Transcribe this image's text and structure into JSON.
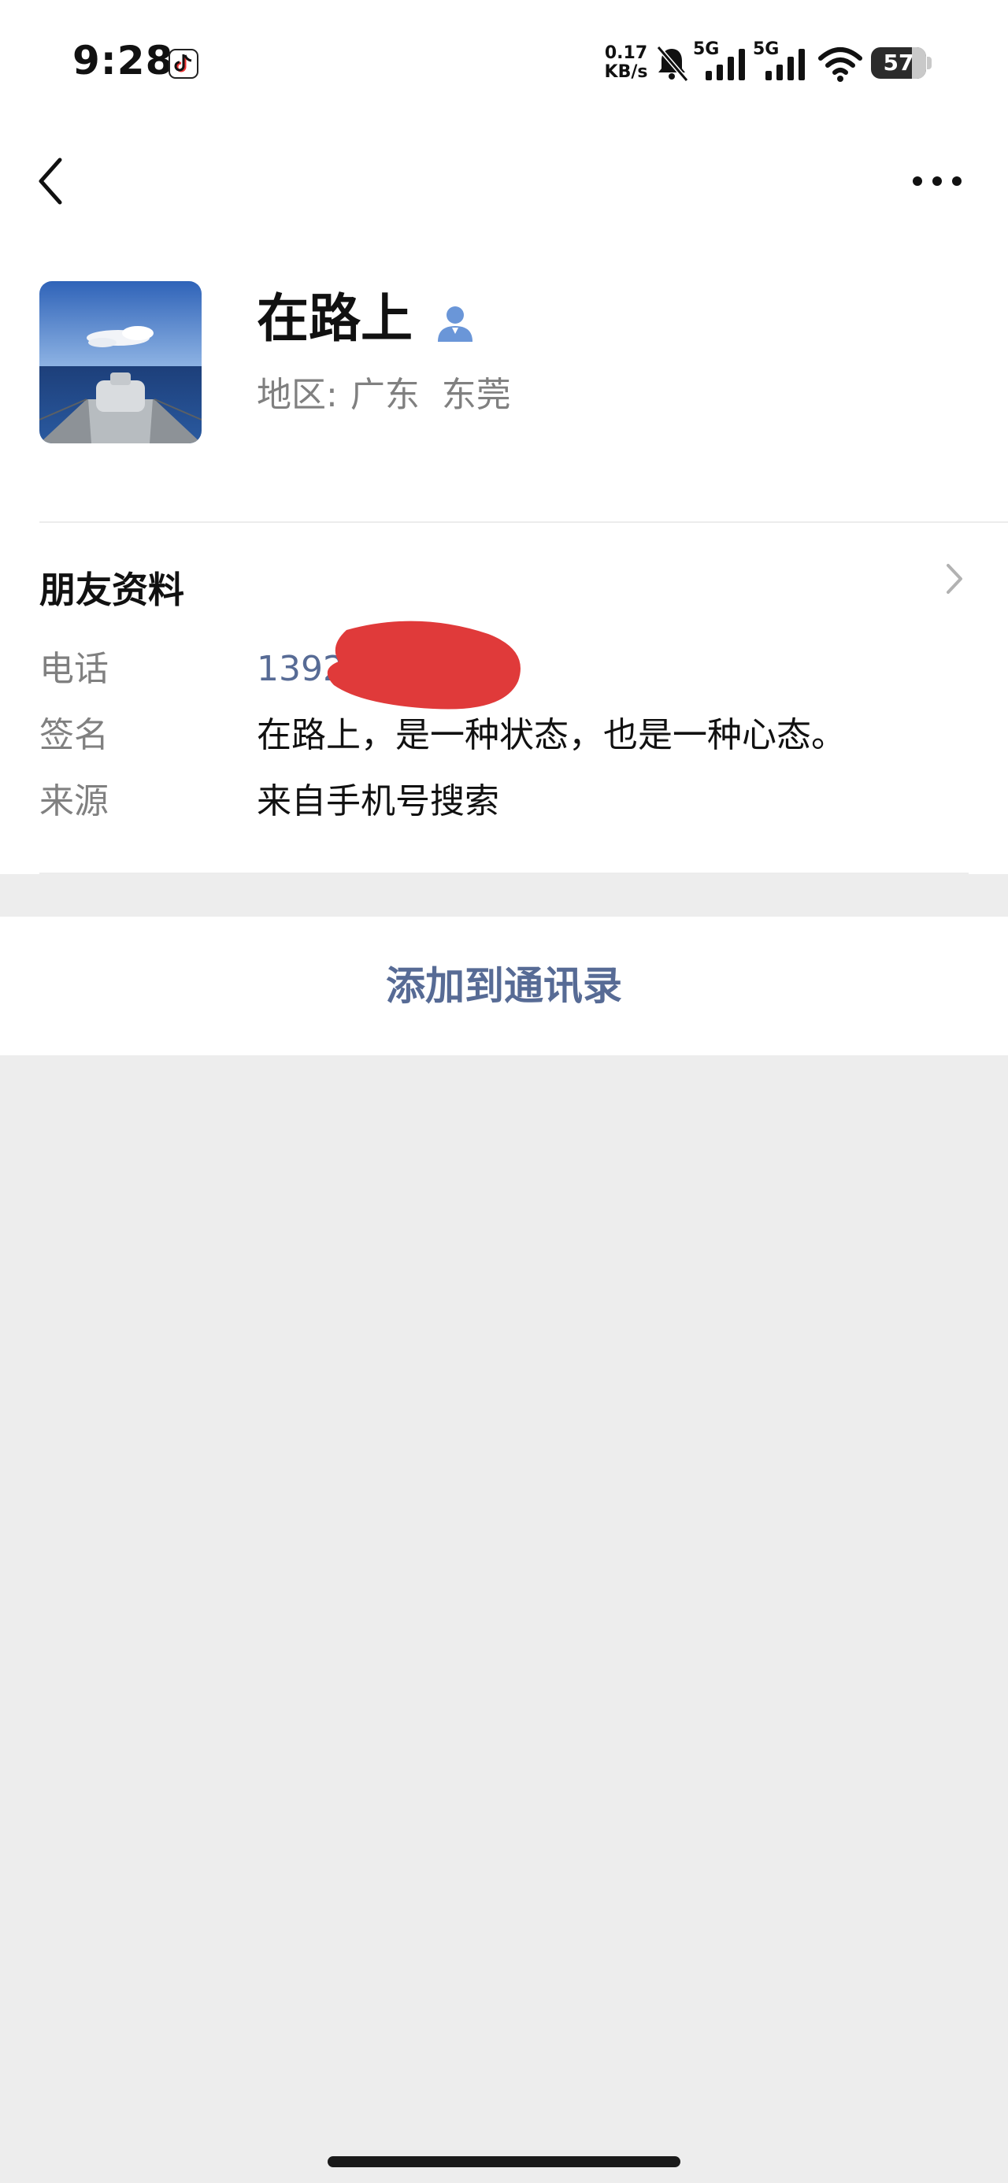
{
  "status_bar": {
    "time": "9:28",
    "net_speed_value": "0.17",
    "net_speed_unit": "KB/s",
    "signal_1_label": "5G",
    "signal_2_label": "5G",
    "battery_level": "57",
    "icons": [
      "tiktok-icon",
      "mute-bell-icon",
      "signal-icon",
      "signal-icon",
      "wifi-icon",
      "battery-icon"
    ]
  },
  "nav": {
    "back_icon": "chevron-left-icon",
    "more_icon": "more-dots-icon"
  },
  "profile": {
    "nickname": "在路上",
    "gender_icon": "person-icon",
    "region_label": "地区:",
    "region_value": "广东  东莞"
  },
  "friend_info": {
    "section_title": "朋友资料",
    "rows": [
      {
        "label": "电话",
        "value": "13925"
      },
      {
        "label": "签名",
        "value": "在路上，是一种状态，也是一种心态。"
      },
      {
        "label": "来源",
        "value": "来自手机号搜索"
      }
    ]
  },
  "actions": {
    "add_contact_label": "添加到通讯录"
  },
  "colors": {
    "link": "#576b95",
    "background": "#ededed",
    "redaction": "#e03a3a"
  }
}
